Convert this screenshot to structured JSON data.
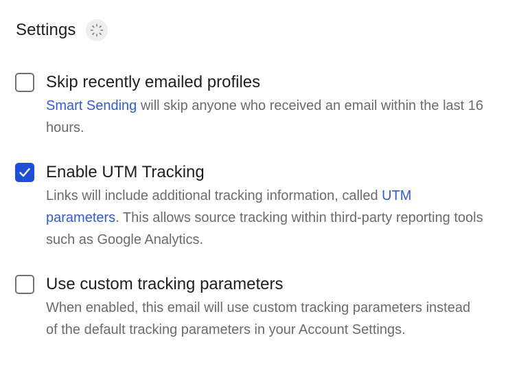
{
  "settings": {
    "title": "Settings",
    "loading_icon": "loading-spinner-icon",
    "accent_color": "#1f4fd6",
    "link_color": "#2e5be0",
    "options": [
      {
        "label": "Skip recently emailed profiles",
        "checked": false,
        "description": {
          "link": "Smart Sending",
          "text_after": " will skip anyone who received an email within the last 16 hours."
        }
      },
      {
        "label": "Enable UTM Tracking",
        "checked": true,
        "description": {
          "text_before": "Links will include additional tracking information, called ",
          "link": "UTM parameters",
          "text_after": ". This allows source tracking within third-party reporting tools such as Google Analytics."
        }
      },
      {
        "label": "Use custom tracking parameters",
        "checked": false,
        "description": {
          "text": "When enabled, this email will use custom tracking parameters instead of the default tracking parameters in your Account Settings."
        }
      }
    ]
  }
}
